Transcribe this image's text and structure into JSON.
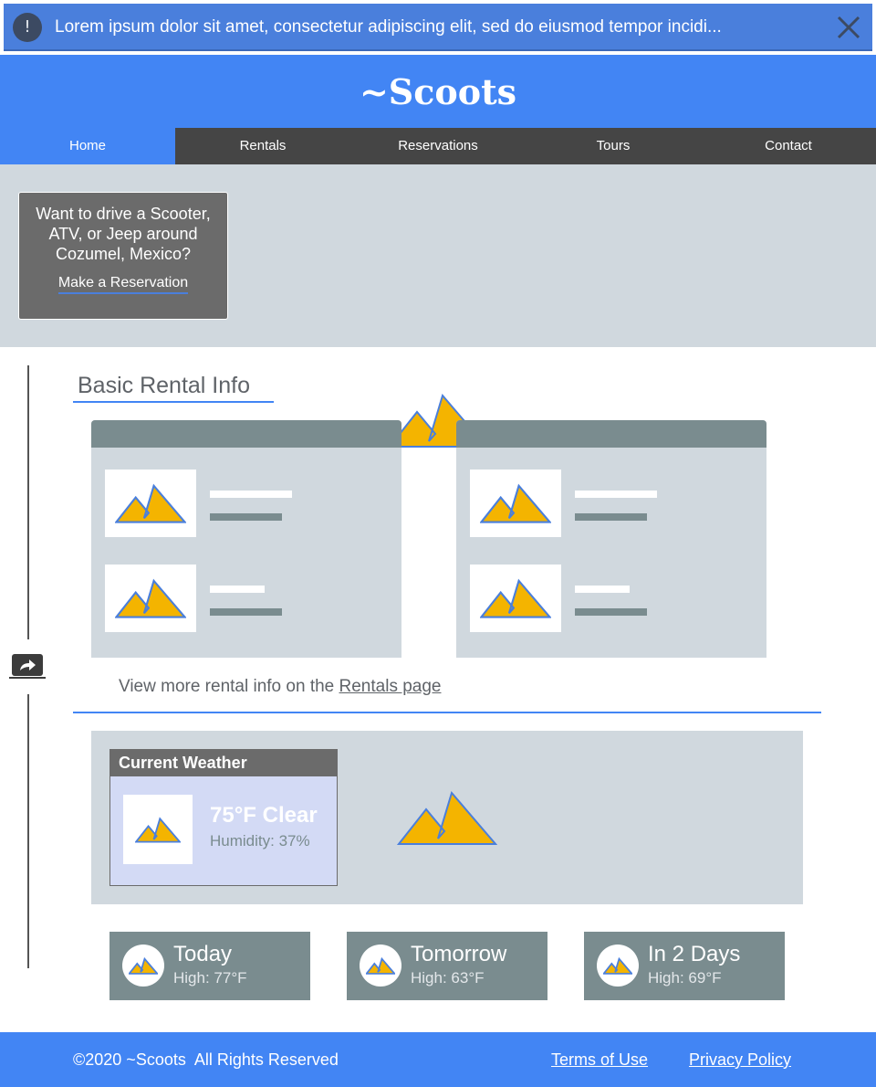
{
  "banner": {
    "icon": "alert-icon",
    "icon_glyph": "!",
    "message": "Lorem ipsum dolor sit amet, consectetur adipiscing elit, sed do eiusmod tempor incidi..."
  },
  "header": {
    "site_title": "~Scoots"
  },
  "nav": {
    "items": [
      {
        "label": "Home",
        "active": true
      },
      {
        "label": "Rentals",
        "active": false
      },
      {
        "label": "Reservations",
        "active": false
      },
      {
        "label": "Tours",
        "active": false
      },
      {
        "label": "Contact",
        "active": false
      }
    ]
  },
  "hero": {
    "question": "Want to drive a Scooter, ATV, or Jeep around Cozumel, Mexico?",
    "cta_label": "Make a Reservation"
  },
  "rental_info": {
    "title": "Basic Rental Info",
    "more_info_prefix": "View more rental info on the ",
    "more_info_link": "Rentals page"
  },
  "weather": {
    "title": "Current Weather",
    "temperature": "75°F Clear",
    "humidity": "Humidity: 37%",
    "forecast": [
      {
        "day": "Today",
        "high": "High: 77°F"
      },
      {
        "day": "Tomorrow",
        "high": "High: 63°F"
      },
      {
        "day": "In 2 Days",
        "high": "High: 69°F"
      }
    ]
  },
  "footer": {
    "copyright": "©2020 ~Scoots  All Rights Reserved",
    "terms": "Terms of Use",
    "privacy": "Privacy Policy"
  },
  "colors": {
    "brand_blue": "#4285f4",
    "nav_dark": "#454545",
    "panel_gray": "#d0d8de",
    "slate": "#7a8c8f",
    "image_yellow": "#f4b400"
  }
}
